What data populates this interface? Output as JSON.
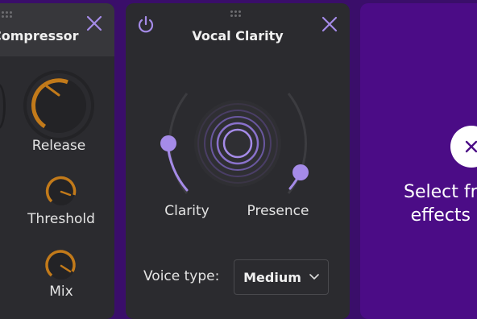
{
  "compressor": {
    "title": "Compressor",
    "knobs": [
      {
        "label": "Release",
        "level": 0.3
      },
      {
        "label": "Threshold",
        "level": 0.85
      },
      {
        "label": "Mix",
        "level": 0.8
      }
    ]
  },
  "vocal_clarity": {
    "title": "Vocal Clarity",
    "clarity_label": "Clarity",
    "presence_label": "Presence",
    "voice_type_label": "Voice type:",
    "voice_type_value": "Medium"
  },
  "add_effect": {
    "line1": "Select fr",
    "line2": "effects"
  },
  "colors": {
    "accent_purple": "#a58be8",
    "knob_orange": "#c27a1a",
    "background": "#3a0e6a"
  }
}
